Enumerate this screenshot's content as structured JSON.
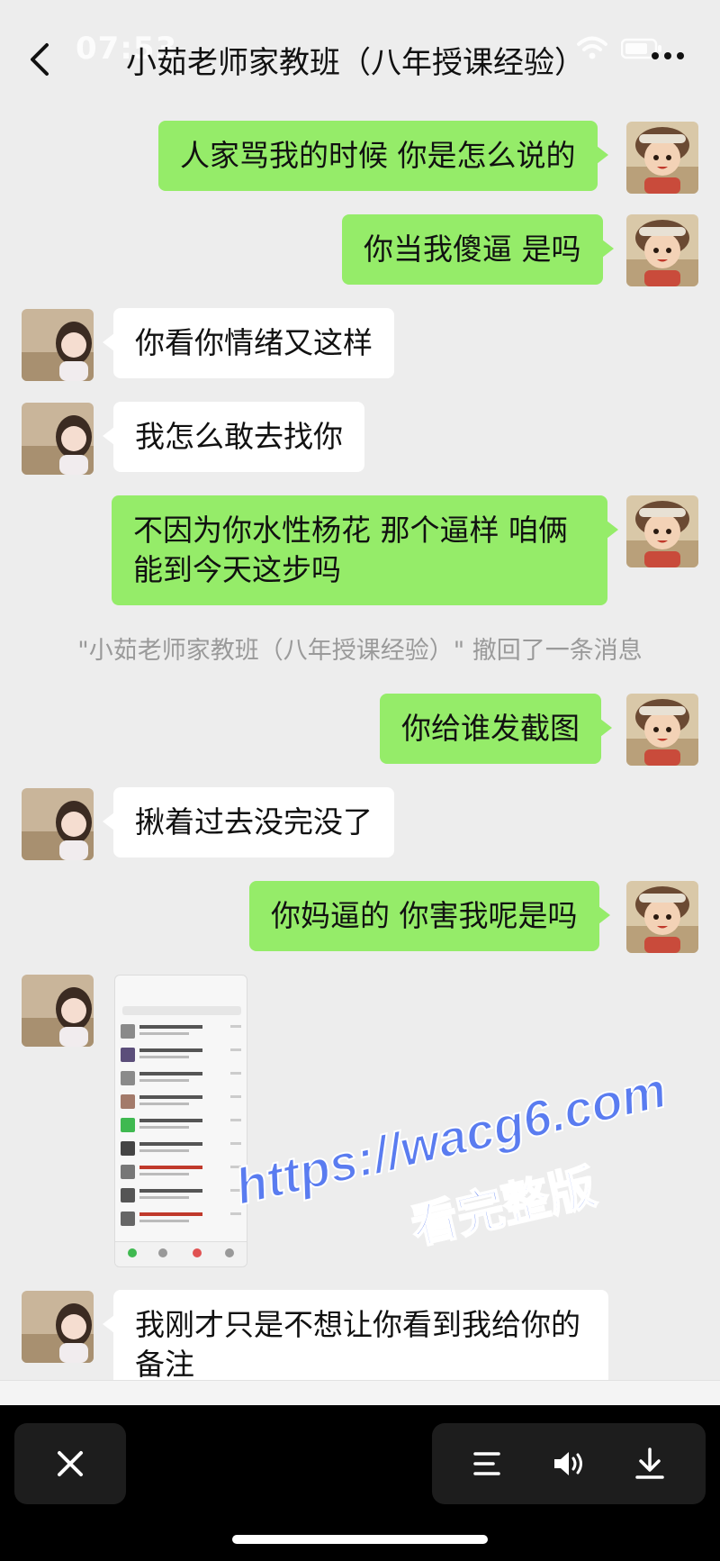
{
  "status_bar": {
    "time": "07:53"
  },
  "header": {
    "title": "小茹老师家教班（八年授课经验）"
  },
  "messages": [
    {
      "text": "人家骂我的时候 你是怎么说的"
    },
    {
      "text": "你当我傻逼 是吗"
    },
    {
      "text": "你看你情绪又这样"
    },
    {
      "text": "我怎么敢去找你"
    },
    {
      "line1": "不因为你水性杨花 那个逼样 咱俩",
      "line2": "能到今天这步吗"
    },
    {
      "text": "你给谁发截图"
    },
    {
      "text": "揪着过去没完没了"
    },
    {
      "text": "你妈逼的 你害我呢是吗"
    },
    {
      "line1": "我刚才只是不想让你看到我给你的",
      "line2": "备注"
    }
  ],
  "recall_notice": "\"小茹老师家教班（八年授课经验）\" 撤回了一条消息",
  "watermark": {
    "line1": "https://wacg6.com",
    "line2": "看完整版"
  },
  "icons": [
    "back-icon",
    "wifi-icon",
    "battery-icon",
    "more-icon",
    "close-icon",
    "list-icon",
    "volume-icon",
    "download-icon"
  ]
}
